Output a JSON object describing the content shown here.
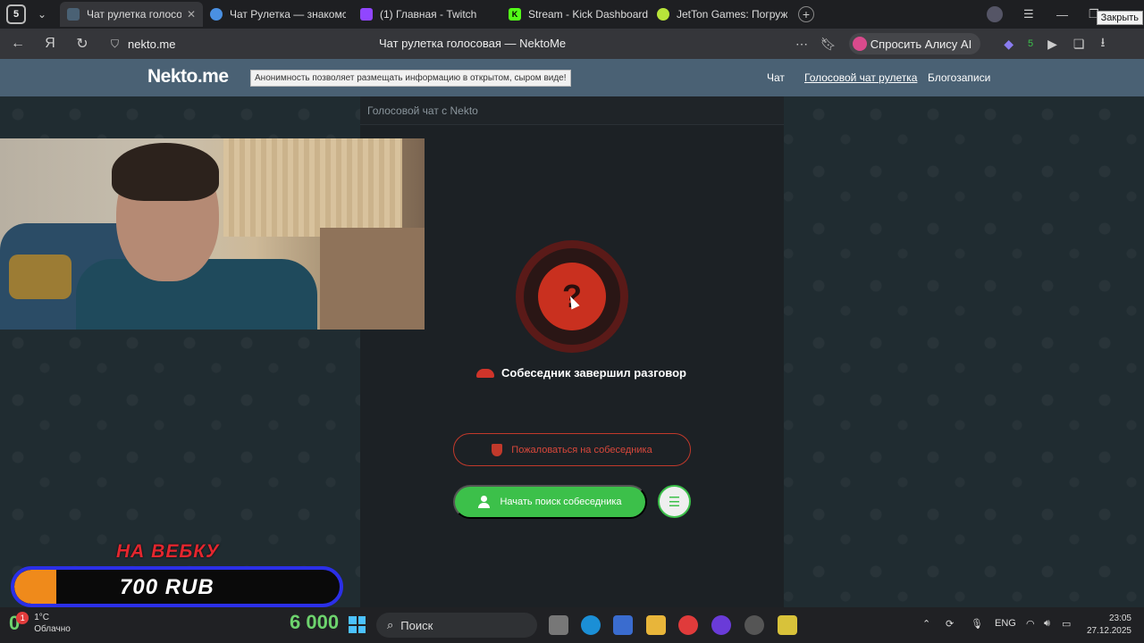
{
  "browser": {
    "tab_count": "5",
    "tabs": [
      {
        "label": "Чат рулетка голосовая",
        "active": true,
        "favicon_color": "#4a6174"
      },
      {
        "label": "Чат Рулетка — знакомств",
        "active": false,
        "favicon_color": "#4a90e2"
      },
      {
        "label": "(1) Главная - Twitch",
        "active": false,
        "favicon_color": "#9146ff"
      },
      {
        "label": "Stream - Kick Dashboard",
        "active": false,
        "favicon_color": "#53fc18"
      },
      {
        "label": "JetTon Games: Погружен",
        "active": false,
        "favicon_color": "#b8e43a"
      }
    ],
    "close_tooltip": "Закрыть",
    "url": "nekto.me",
    "page_title": "Чат рулетка голосовая — NektoMe",
    "alice_label": "Спросить Алису AI",
    "extension_badge": "5"
  },
  "site": {
    "logo": "Nekto.me",
    "notice": "Анонимность позволяет размещать информацию в открытом, сыром виде!",
    "nav": [
      "Чат",
      "Голосовой чат рулетка",
      "Блогозаписи"
    ]
  },
  "chat": {
    "panel_title": "Голосовой чат с Nekto",
    "avatar_symbol": "?",
    "status_text": "Собеседник завершил разговор",
    "report_label": "Пожаловаться на собеседника",
    "search_label": "Начать поиск собеседника"
  },
  "stream_overlay": {
    "title": "НА ВЕБКУ",
    "amount": "700 RUB",
    "progress": 0.13,
    "colors": {
      "title": "#e3262e",
      "border": "#2b2fe8",
      "fill": "#ef8a1b"
    }
  },
  "taskbar": {
    "weather_value": "0",
    "weather_badge": "1",
    "temperature": "1°C",
    "condition": "Облачно",
    "counter": "6 000",
    "search_placeholder": "Поиск",
    "lang": "ENG",
    "time": "23:05",
    "date": "27.12.2025"
  }
}
